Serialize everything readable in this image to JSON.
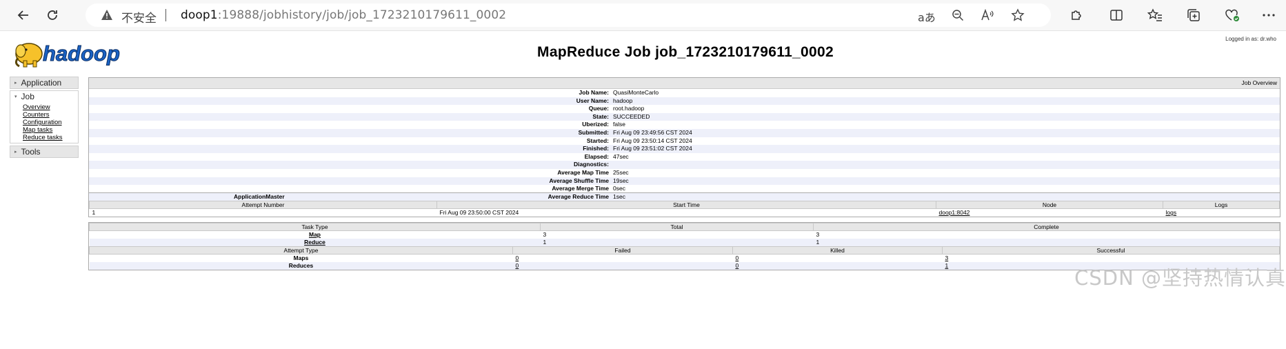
{
  "browser": {
    "insecure_label": "不安全",
    "url_host": "doop1",
    "url_path": ":19888/jobhistory/job/job_1723210179611_0002",
    "reader_label": "aあ"
  },
  "page": {
    "logged_in": "Logged in as: dr.who",
    "logo_text": "hadoop",
    "title": "MapReduce Job job_1723210179611_0002"
  },
  "nav": {
    "application": "Application",
    "job": "Job",
    "job_links": [
      "Overview",
      "Counters",
      "Configuration",
      "Map tasks",
      "Reduce tasks"
    ],
    "tools": "Tools"
  },
  "overview": {
    "caption": "Job Overview",
    "rows": [
      {
        "k": "Job Name:",
        "v": "QuasiMonteCarlo"
      },
      {
        "k": "User Name:",
        "v": "hadoop"
      },
      {
        "k": "Queue:",
        "v": "root.hadoop"
      },
      {
        "k": "State:",
        "v": "SUCCEEDED"
      },
      {
        "k": "Uberized:",
        "v": "false"
      },
      {
        "k": "Submitted:",
        "v": "Fri Aug 09 23:49:56 CST 2024"
      },
      {
        "k": "Started:",
        "v": "Fri Aug 09 23:50:14 CST 2024"
      },
      {
        "k": "Finished:",
        "v": "Fri Aug 09 23:51:02 CST 2024"
      },
      {
        "k": "Elapsed:",
        "v": "47sec"
      },
      {
        "k": "Diagnostics:",
        "v": ""
      },
      {
        "k": "Average Map Time",
        "v": "25sec"
      },
      {
        "k": "Average Shuffle Time",
        "v": "19sec"
      },
      {
        "k": "Average Merge Time",
        "v": "0sec"
      },
      {
        "k": "Average Reduce Time",
        "v": "1sec"
      }
    ]
  },
  "am": {
    "caption": "ApplicationMaster",
    "headers": [
      "Attempt Number",
      "Start Time",
      "Node",
      "Logs"
    ],
    "row": {
      "attempt": "1",
      "start": "Fri Aug 09 23:50:00 CST 2024",
      "node": "doop1:8042",
      "logs": "logs"
    }
  },
  "tasks": {
    "headers": [
      "Task Type",
      "Total",
      "Complete"
    ],
    "rows": [
      {
        "type": "Map",
        "total": "3",
        "complete": "3"
      },
      {
        "type": "Reduce",
        "total": "1",
        "complete": "1"
      }
    ],
    "attempt_headers": [
      "Attempt Type",
      "Failed",
      "Killed",
      "Successful"
    ],
    "attempt_rows": [
      {
        "type": "Maps",
        "failed": "0",
        "killed": "0",
        "successful": "3"
      },
      {
        "type": "Reduces",
        "failed": "0",
        "killed": "0",
        "successful": "1"
      }
    ]
  },
  "watermark": "CSDN @坚持热情认真"
}
